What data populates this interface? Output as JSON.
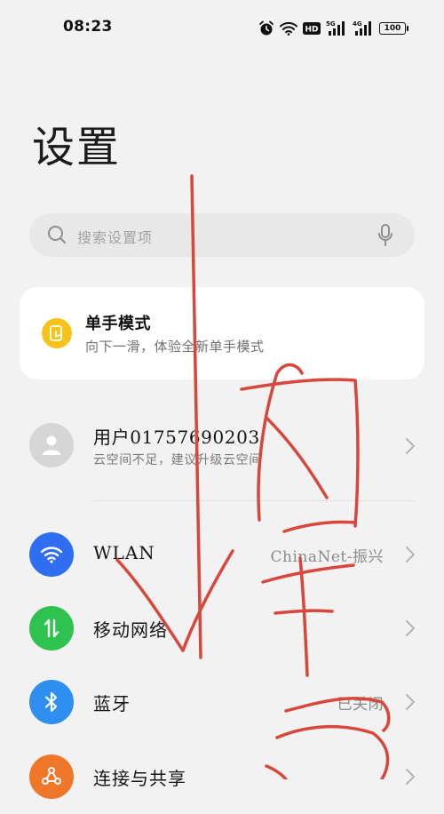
{
  "status_bar": {
    "time": "08:23",
    "hd_label": "HD",
    "net1_label": "5G",
    "net2_label": "4G",
    "battery": "100",
    "icons": [
      "alarm-icon",
      "wifi-icon",
      "hd-icon",
      "signal-icon",
      "signal-icon",
      "battery-icon"
    ]
  },
  "page": {
    "title": "设置"
  },
  "search": {
    "placeholder": "搜索设置项"
  },
  "one_hand_card": {
    "title": "单手模式",
    "subtitle": "向下一滑，体验全新单手模式",
    "badge_color": "#f6c31b"
  },
  "account": {
    "name": "用户01757690203",
    "subtitle": "云空间不足，建议升级云空间"
  },
  "settings": [
    {
      "label": "WLAN",
      "value": "ChinaNet-振兴",
      "icon": "wifi-icon",
      "color": "#2f6ef0"
    },
    {
      "label": "移动网络",
      "value": "",
      "icon": "mobile-data-icon",
      "color": "#2fc24f"
    },
    {
      "label": "蓝牙",
      "value": "已关闭",
      "icon": "bluetooth-icon",
      "color": "#2f8ff0"
    },
    {
      "label": "连接与共享",
      "value": "",
      "icon": "share-icon",
      "color": "#f0772a"
    }
  ],
  "annotation_color": "#d8473c"
}
